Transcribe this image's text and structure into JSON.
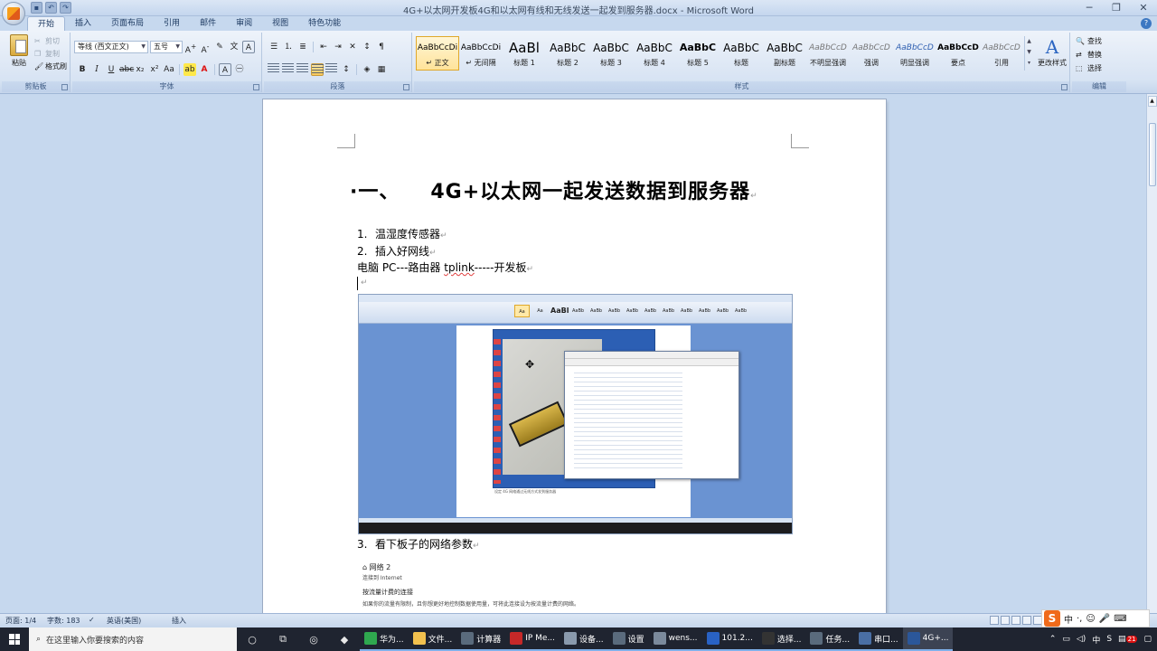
{
  "window": {
    "title": "4G+以太网开发板4G和以太网有线和无线发送一起发到服务器.docx - Microsoft Word",
    "controls": [
      "─",
      "❐",
      "✕"
    ]
  },
  "ribbon": {
    "tabs": [
      "开始",
      "插入",
      "页面布局",
      "引用",
      "邮件",
      "审阅",
      "视图",
      "特色功能"
    ],
    "clipboard": {
      "paste": "粘贴",
      "cut": "剪切",
      "copy": "复制",
      "format_painter": "格式刷",
      "label": "剪贴板"
    },
    "font": {
      "family": "等线 (西文正文)",
      "size": "五号",
      "label": "字体"
    },
    "paragraph": {
      "label": "段落"
    },
    "styles": {
      "label": "样式",
      "items": [
        {
          "sample": "AaBbCcDi",
          "name": "↵ 正文"
        },
        {
          "sample": "AaBbCcDi",
          "name": "↵ 无间隔"
        },
        {
          "sample": "AaBl",
          "name": "标题 1"
        },
        {
          "sample": "AaBbC",
          "name": "标题 2"
        },
        {
          "sample": "AaBbC",
          "name": "标题 3"
        },
        {
          "sample": "AaBbC",
          "name": "标题 4"
        },
        {
          "sample": "AaBbC",
          "name": "标题 5"
        },
        {
          "sample": "AaBbC",
          "name": "标题"
        },
        {
          "sample": "AaBbC",
          "name": "副标题"
        },
        {
          "sample": "AaBbCcD",
          "name": "不明显强调"
        },
        {
          "sample": "AaBbCcD",
          "name": "强调"
        },
        {
          "sample": "AaBbCcD",
          "name": "明显强调"
        },
        {
          "sample": "AaBbCcD",
          "name": "要点"
        },
        {
          "sample": "AaBbCcD",
          "name": "引用"
        }
      ],
      "change_styles": "更改样式"
    },
    "editing": {
      "label": "编辑",
      "find": "查找",
      "replace": "替换",
      "select": "选择"
    }
  },
  "document": {
    "heading_number": "·一、",
    "heading_text": "4G+以太网一起发送数据到服务器",
    "list": [
      {
        "num": "1.",
        "text": "温湿度传感器"
      },
      {
        "num": "2.",
        "text": "插入好网线"
      }
    ],
    "line_prefix": "电脑 PC---路由器 ",
    "line_misspelled": "tplink",
    "line_suffix": "-----开发板",
    "item3_num": "3.",
    "item3_text": "看下板子的网络参数",
    "embedded_caption": "设定 4G 网络通过无线方式发到服务器",
    "lower_title": "网络 2",
    "lower_sub": "连接到 Internet",
    "lower_section": "按流量计费的连接",
    "lower_body": "如果你的流量有限制，且你想更好地控制数据使用量，可将此连接设为按流量计费的网络。"
  },
  "status_bar": {
    "page": "页面: 1/4",
    "words": "字数: 183",
    "language": "英语(美国)",
    "mode": "插入"
  },
  "ime": {
    "logo": "S",
    "mode": "中"
  },
  "taskbar": {
    "search_placeholder": "在这里输入你要搜索的内容",
    "apps": [
      {
        "label": "华为...",
        "color": "#2fa84f"
      },
      {
        "label": "文件...",
        "color": "#f2c14e"
      },
      {
        "label": "计算器",
        "color": "#5a6b7d"
      },
      {
        "label": "IP Me...",
        "color": "#c62828"
      },
      {
        "label": "设备...",
        "color": "#8a9aad"
      },
      {
        "label": "设置",
        "color": "#5a6b7d"
      },
      {
        "label": "wens...",
        "color": "#7b8a9c"
      },
      {
        "label": "101.2...",
        "color": "#2962c4"
      },
      {
        "label": "选择...",
        "color": "#333333"
      },
      {
        "label": "任务...",
        "color": "#5a6b7d"
      },
      {
        "label": "串口...",
        "color": "#4a6fa5"
      },
      {
        "label": "4G+...",
        "color": "#2b579a"
      }
    ],
    "tray_ime": "中",
    "notification_count": "21"
  }
}
